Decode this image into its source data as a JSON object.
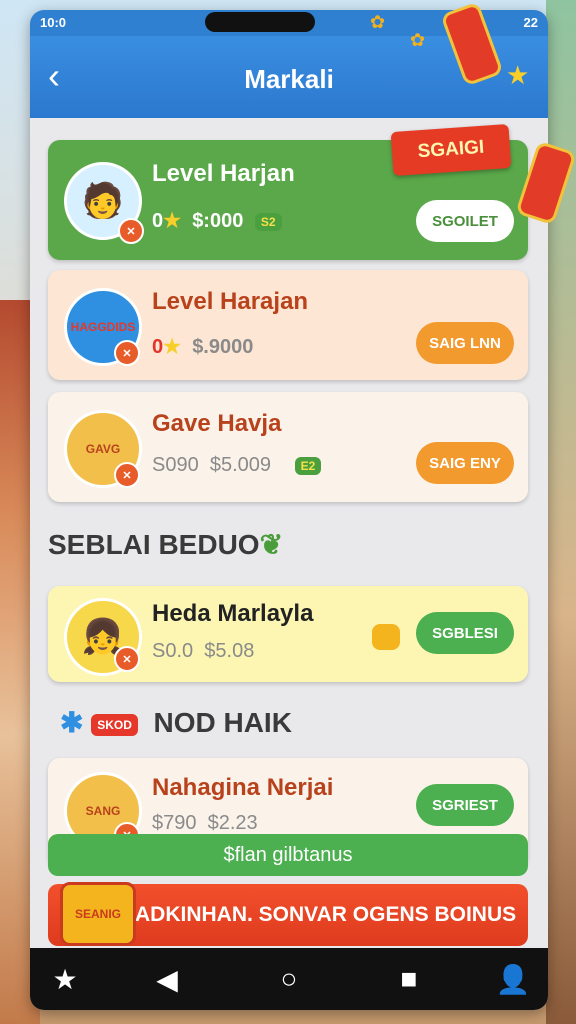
{
  "status": {
    "time": "10:0",
    "battery": "22"
  },
  "header": {
    "title": "Markali"
  },
  "cards": [
    {
      "name": "Level Harjan",
      "count": "0",
      "price": "$:000",
      "chip": "S2",
      "button": "SGOILET"
    },
    {
      "name": "Level Harajan",
      "count": "0",
      "price": "$.9000",
      "button": "SAIG LNN",
      "badge_text": "HAGGDIDS"
    },
    {
      "name": "Gave Havja",
      "count": "S090",
      "price": "$5.009",
      "chip": "E2",
      "button": "SAIG ENY",
      "badge_text": "GAVG"
    },
    {
      "name": "Heda Marlayla",
      "count": "S0.0",
      "price": "$5.08",
      "button": "SGBLESI"
    },
    {
      "name": "Nahagina Nerjai",
      "count": "$790",
      "price": "$2.23",
      "button": "SGRIEST",
      "badge_text": "SANG"
    }
  ],
  "sections": {
    "special": "SEBLAI BEDUO",
    "nod": "NOD HAIK",
    "nod_badge": "SKOD"
  },
  "special_ribbon": "SGAIGI",
  "footer": {
    "green_label": "$flan gilbtanus",
    "red_label": "HADKINHAN. SONVAR OGENS BOINUS",
    "medal_text": "SEANIG"
  },
  "colors": {
    "appbar": "#2b78cf",
    "green_card": "#5aa84a",
    "orange_button": "#f29a2e",
    "green_button": "#4caf50",
    "red_footer": "#e0401f"
  }
}
